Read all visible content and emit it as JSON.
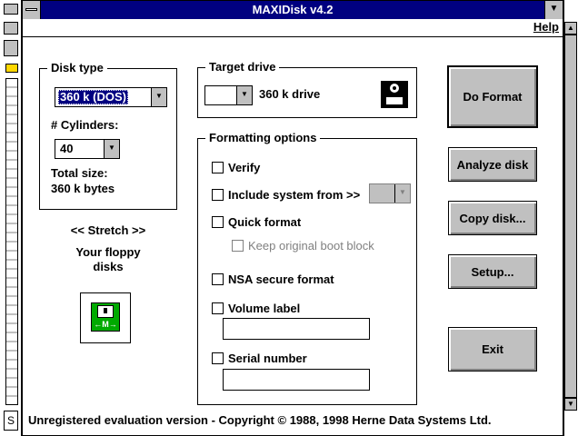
{
  "window": {
    "title": "MAXIDisk v4.2"
  },
  "menu": {
    "help": "Help"
  },
  "disk_type": {
    "group_title": "Disk type",
    "type_value": "360 k (DOS)",
    "cylinders_label": "# Cylinders:",
    "cylinders_value": "40",
    "total_size_label": "Total size:",
    "total_size_value": "360 k bytes"
  },
  "stretch": {
    "label": "<< Stretch >>",
    "caption_line1": "Your floppy",
    "caption_line2": "disks",
    "icon_text": "←M→"
  },
  "target_drive": {
    "group_title": "Target drive",
    "drive_value": "",
    "drive_desc": "360 k drive"
  },
  "options": {
    "group_title": "Formatting options",
    "verify": "Verify",
    "include_system": "Include system from >>",
    "quick_format": "Quick format",
    "keep_boot_block": "Keep original boot block",
    "nsa_secure": "NSA secure format",
    "volume_label": "Volume label",
    "serial_number": "Serial number"
  },
  "buttons": {
    "do_format": "Do Format",
    "analyze_disk": "Analyze disk",
    "copy_disk": "Copy disk...",
    "setup": "Setup...",
    "exit": "Exit"
  },
  "status": "Unregistered evaluation version - Copyright © 1988, 1998 Herne Data Systems Ltd.",
  "colors": {
    "titlebar": "#000080",
    "button_face": "#c0c0c0",
    "drive_icon": "#000000",
    "stretch_icon": "#00aa00"
  },
  "icons": [
    "system-menu-icon",
    "minimize-icon",
    "floppy-drive-icon",
    "stretch-disk-icon",
    "dropdown-arrow-icon"
  ]
}
